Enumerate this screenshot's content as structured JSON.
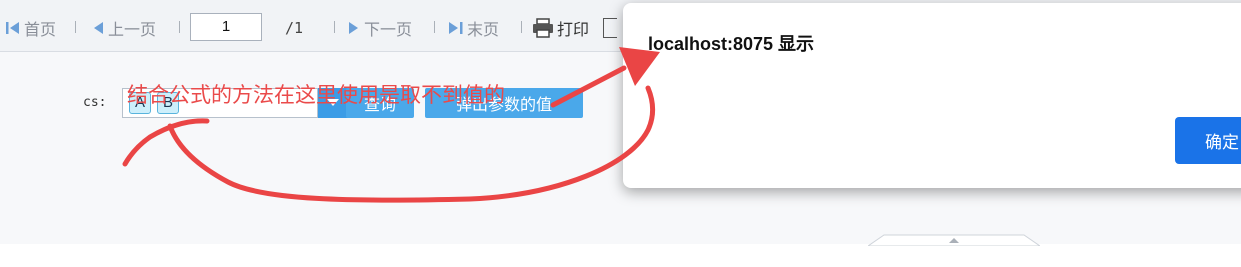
{
  "toolbar": {
    "first_label": "首页",
    "prev_label": "上一页",
    "page_value": "1",
    "page_total": "/1",
    "next_label": "下一页",
    "last_label": "末页",
    "print_label": "打印"
  },
  "form": {
    "cs_label": "cs:",
    "tags": [
      "A",
      "B"
    ],
    "query_label": "查询",
    "popup_label": "弹出参数的值"
  },
  "dialog": {
    "title": "localhost:8075 显示",
    "ok_label": "确定"
  },
  "annotation": {
    "message": "结合公式的方法在这里使用是取不到值的",
    "color": "#ea4a4a"
  },
  "colors": {
    "accent": "#4aa8ea",
    "dialog_button": "#1a73e8",
    "tag_bg": "#cdeffb"
  }
}
